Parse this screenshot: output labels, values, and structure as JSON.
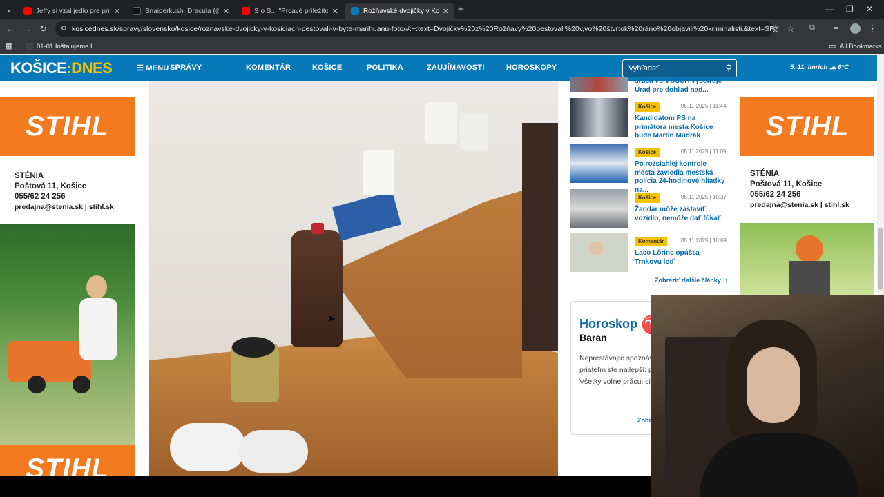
{
  "browser": {
    "tabs": [
      {
        "title": "Jeffy si vzal jedlo pre priateľku",
        "favicon_color": "#ff0000"
      },
      {
        "title": "Snaiperkush_Dracula (@snaiper",
        "favicon_color": "#111111"
      },
      {
        "title": "S o S... \"Prcavé príležitosti\" - Yo",
        "favicon_color": "#ff0000"
      },
      {
        "title": "Rožňavské dvojičky v Košiciach",
        "favicon_color": "#0879b8"
      }
    ],
    "new_tab": "+",
    "url_host": "kosicednes.sk",
    "url_path": "/spravy/slovensko/kosice/roznavske-dvojicky-v-kosiciach-pestovali-v-byte-marihuanu-foto/#:~:text=Dvojičky%20z%20Rožňavy%20pestovali%20v,vo%20štvrtok%20ráno%20objavili%20kriminalisti.&text=SR%20-%20Košický%20kra...",
    "bookmark": "01-01 Inštalujeme Li...",
    "all_bookmarks": "All Bookmarks"
  },
  "site": {
    "logo_left": "KOŠICE",
    "logo_sep": ":",
    "logo_right": "DNES",
    "menu": "MENU",
    "nav": [
      "SPRÁVY",
      "KOMENTÁR",
      "KOŠICE",
      "POLITIKA",
      "ZAUJÍMAVOSTI",
      "HOROSKOPY"
    ],
    "search_placeholder": "Vyhľadať...",
    "date_name": "5. 11. Imrich",
    "weather": "6°C"
  },
  "ads": {
    "brand": "STIHL",
    "left": {
      "company": "STÉNIA",
      "address": "Poštová 11, Košice",
      "phone": "055/62 24 256",
      "contact": "predajna@stenia.sk | stihl.sk"
    },
    "right": {
      "company": "STÉNIA",
      "address": "Poštová 11, Košice",
      "phone": "055/62 24 256",
      "contact": "predajna@stenia.sk | stihl.sk"
    }
  },
  "articles": [
    {
      "title": "srdca vo VOŠCH vyšetruje Úrad pre dohľad nad...",
      "tag": "",
      "date": ""
    },
    {
      "title": "Kandidátom PS na primátora mesta Košice bude Martin Mudrák",
      "tag": "Košice",
      "date": "05.11.2025 | 11:44"
    },
    {
      "title": "Po rozsiahlej kontrole mesta zaviedla mestská polícia 24-hodinové hliadky na...",
      "tag": "Košice",
      "date": "05.11.2025 | 11:05"
    },
    {
      "title": "Žandár môže zastaviť vozidlo, nemôže dať fúkať",
      "tag": "Košice",
      "date": "05.11.2025 | 10:37"
    },
    {
      "title": "Laco Lőrinc opúšťa Trnkovu loď",
      "tag": "Komentár",
      "date": "05.11.2025 | 10:09"
    }
  ],
  "more_articles": "Zobraziť ďalšie články",
  "horoscope": {
    "title": "Horoskop",
    "symbol": "♈",
    "sign": "Baran",
    "text": "Neprestávajte spoznáv stretávať sa s priateľm ste najlepší: plánujte, s kreatívny. Všetky voľne prácu, si naplno užite.",
    "link": "Zobra"
  }
}
